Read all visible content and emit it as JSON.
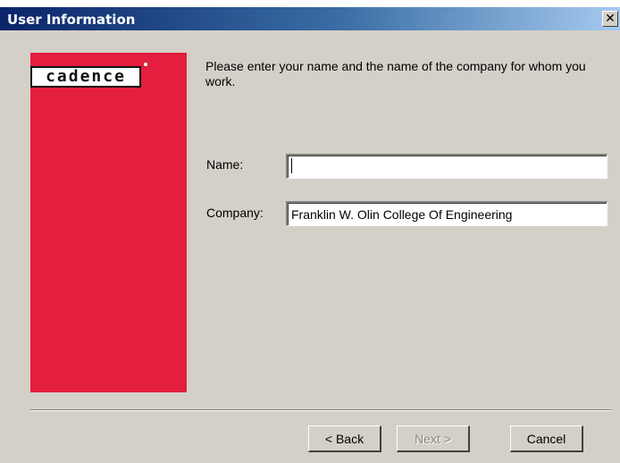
{
  "window": {
    "title": "User Information",
    "close_glyph": "✕"
  },
  "branding": {
    "logo_text": "cadence",
    "panel_color": "#e31e3e"
  },
  "main": {
    "instruction": "Please enter your name and the name of the company for whom you work."
  },
  "form": {
    "name": {
      "label": "Name:",
      "value": ""
    },
    "company": {
      "label": "Company:",
      "value": "Franklin W. Olin College Of Engineering"
    }
  },
  "buttons": {
    "back": "< Back",
    "next": "Next >",
    "cancel": "Cancel"
  }
}
